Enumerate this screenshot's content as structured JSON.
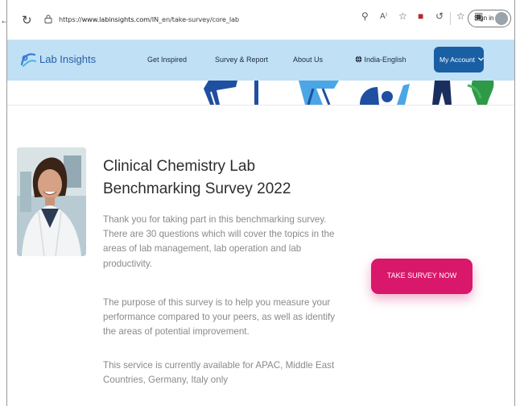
{
  "browser": {
    "url_prefix": "https://",
    "url_host": "www.labinsights.com",
    "url_path": "/IN_en/take-survey/core_lab",
    "signin_label": "Sign in"
  },
  "nav": {
    "brand": "Lab Insights",
    "links": [
      "Get Inspired",
      "Survey & Report",
      "About Us"
    ],
    "language": "India-English",
    "account_label": "My Account"
  },
  "survey": {
    "title": "Clinical Chemistry Lab Benchmarking Survey 2022",
    "paragraphs": [
      "Thank you for taking part in this benchmarking survey. There are 30 questions which will cover the topics in the areas of lab management, lab operation and lab productivity.",
      "The purpose of this survey is to help you measure your performance compared to your peers, as well as identify the areas of potential improvement.",
      "This service is currently available for APAC, Middle East Countries, Germany, Italy only"
    ],
    "cta_label": "TAKE SURVEY NOW"
  },
  "colors": {
    "nav_bg": "#bfe0f5",
    "brand_blue": "#2a5fa8",
    "account_bg": "#1a5fa3",
    "cta_bg": "#d9176b"
  },
  "icons": [
    "back-arrow-icon",
    "reload-icon",
    "lock-icon",
    "key-icon",
    "read-aloud-icon",
    "favorite-icon",
    "extension-icon",
    "refresh-extension-icon",
    "favorites-bar-icon",
    "collections-icon",
    "globe-icon",
    "chevron-down-icon",
    "logo-icon"
  ]
}
